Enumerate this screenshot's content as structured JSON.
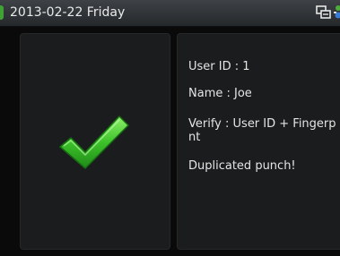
{
  "status_bar": {
    "date_text": "2013-02-22  Friday",
    "accent_color": "#3ea334",
    "icons": [
      "network-icon",
      "verify-mode-icon"
    ]
  },
  "result": {
    "icon": "checkmark-icon",
    "icon_color": "#3dc22a",
    "user_id": "User ID : 1",
    "name": "Name : Joe",
    "verify": "Verify : User ID + Fingerp\nnt",
    "message": "Duplicated punch!"
  }
}
